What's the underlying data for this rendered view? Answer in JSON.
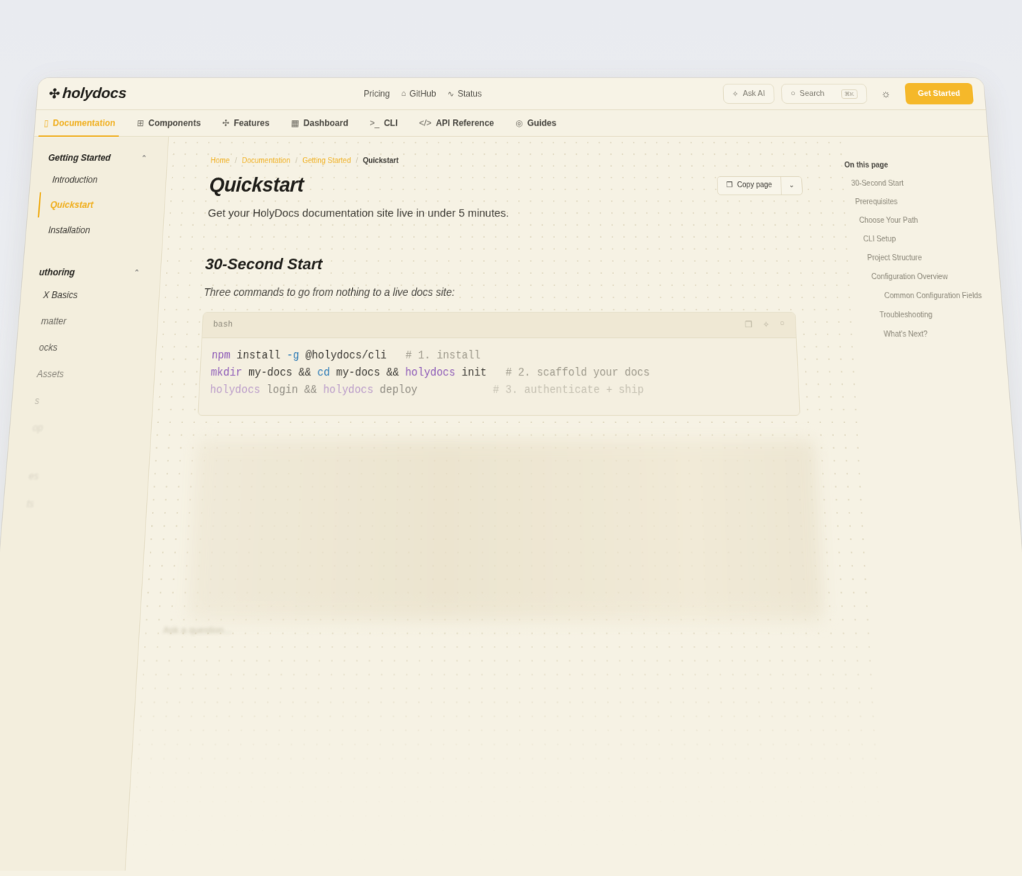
{
  "brand": {
    "name": "holydocs",
    "mark": "✣"
  },
  "topnav": [
    {
      "label": "Pricing",
      "icon": ""
    },
    {
      "label": "GitHub",
      "icon": "github-icon"
    },
    {
      "label": "Status",
      "icon": "activity-icon"
    }
  ],
  "actions": {
    "ask_ai": "Ask AI",
    "search_placeholder": "Search",
    "search_kbd": "⌘K",
    "cta": "Get Started"
  },
  "tabs": [
    {
      "label": "Documentation",
      "active": true
    },
    {
      "label": "Components"
    },
    {
      "label": "Features"
    },
    {
      "label": "Dashboard"
    },
    {
      "label": "CLI"
    },
    {
      "label": "API Reference"
    },
    {
      "label": "Guides"
    }
  ],
  "sidebar": {
    "groups": [
      {
        "title": "Getting Started",
        "items": [
          "Introduction",
          "Quickstart",
          "Installation"
        ],
        "active": "Quickstart"
      },
      {
        "title": "uthoring",
        "items": [
          "X Basics",
          "matter",
          "ocks",
          "Assets",
          "s",
          "op",
          "es",
          "ts"
        ]
      }
    ]
  },
  "breadcrumb": [
    "Home",
    "Documentation",
    "Getting Started",
    "Quickstart"
  ],
  "page": {
    "title": "Quickstart",
    "copy_label": "Copy page",
    "lead": "Get your HolyDocs documentation site live in under 5 minutes.",
    "section_title": "30-Second Start",
    "section_text": "Three commands to go from nothing to a live docs site:",
    "code_lang": "bash",
    "code_lines": [
      {
        "cmd": "npm",
        "rest": " install ",
        "flag": "-g",
        "rest2": " @holydocs/cli",
        "comment": "   # 1. install"
      },
      {
        "cmd": "mkdir",
        "rest": " my-docs && ",
        "flag": "cd",
        "rest2": " my-docs && ",
        "cmd2": "holydocs",
        "rest3": " init",
        "comment": "   # 2. scaffold your docs"
      },
      {
        "cmd": "holydocs",
        "rest": " login && ",
        "cmd2": "holydocs",
        "rest2": " deploy",
        "comment": "            # 3. authenticate + ship"
      }
    ],
    "ask_placeholder": "Ask a question..."
  },
  "toc": {
    "title": "On this page",
    "items": [
      "30-Second Start",
      "Prerequisites",
      "Choose Your Path",
      "CLI Setup",
      "Project Structure",
      "Configuration Overview",
      "Common Configuration Fields",
      "Troubleshooting",
      "What's Next?"
    ]
  },
  "colors": {
    "accent": "#f0b022",
    "cta": "#f5b82a",
    "background": "#f6f2e4"
  }
}
